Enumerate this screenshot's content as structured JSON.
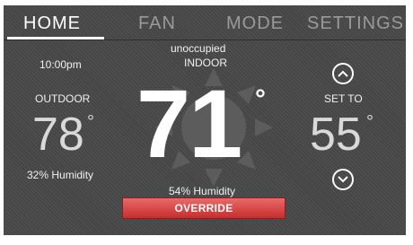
{
  "tabs": [
    {
      "label": "HOME",
      "active": true
    },
    {
      "label": "FAN",
      "active": false
    },
    {
      "label": "MODE",
      "active": false
    },
    {
      "label": "SETTINGS",
      "active": false
    }
  ],
  "status": {
    "time": "10:00pm",
    "occupancy": "unoccupied",
    "indoor_label": "INDOOR"
  },
  "outdoor": {
    "label": "OUTDOOR",
    "temperature": "78",
    "degree_symbol": "°",
    "humidity": "32% Humidity"
  },
  "indoor": {
    "temperature": "71",
    "degree_symbol": "°",
    "humidity": "54% Humidity"
  },
  "setpoint": {
    "label": "SET TO",
    "temperature": "55",
    "degree_symbol": "°"
  },
  "override_button": {
    "label": "OVERRIDE"
  },
  "icons": {
    "background": "sun-icon",
    "up": "chevron-up-icon",
    "down": "chevron-down-icon"
  },
  "colors": {
    "screen_bg": "#4a4a4a",
    "override_red": "#c82d2d",
    "active_tab": "#ffffff",
    "inactive_tab": "#9a9a9a"
  }
}
